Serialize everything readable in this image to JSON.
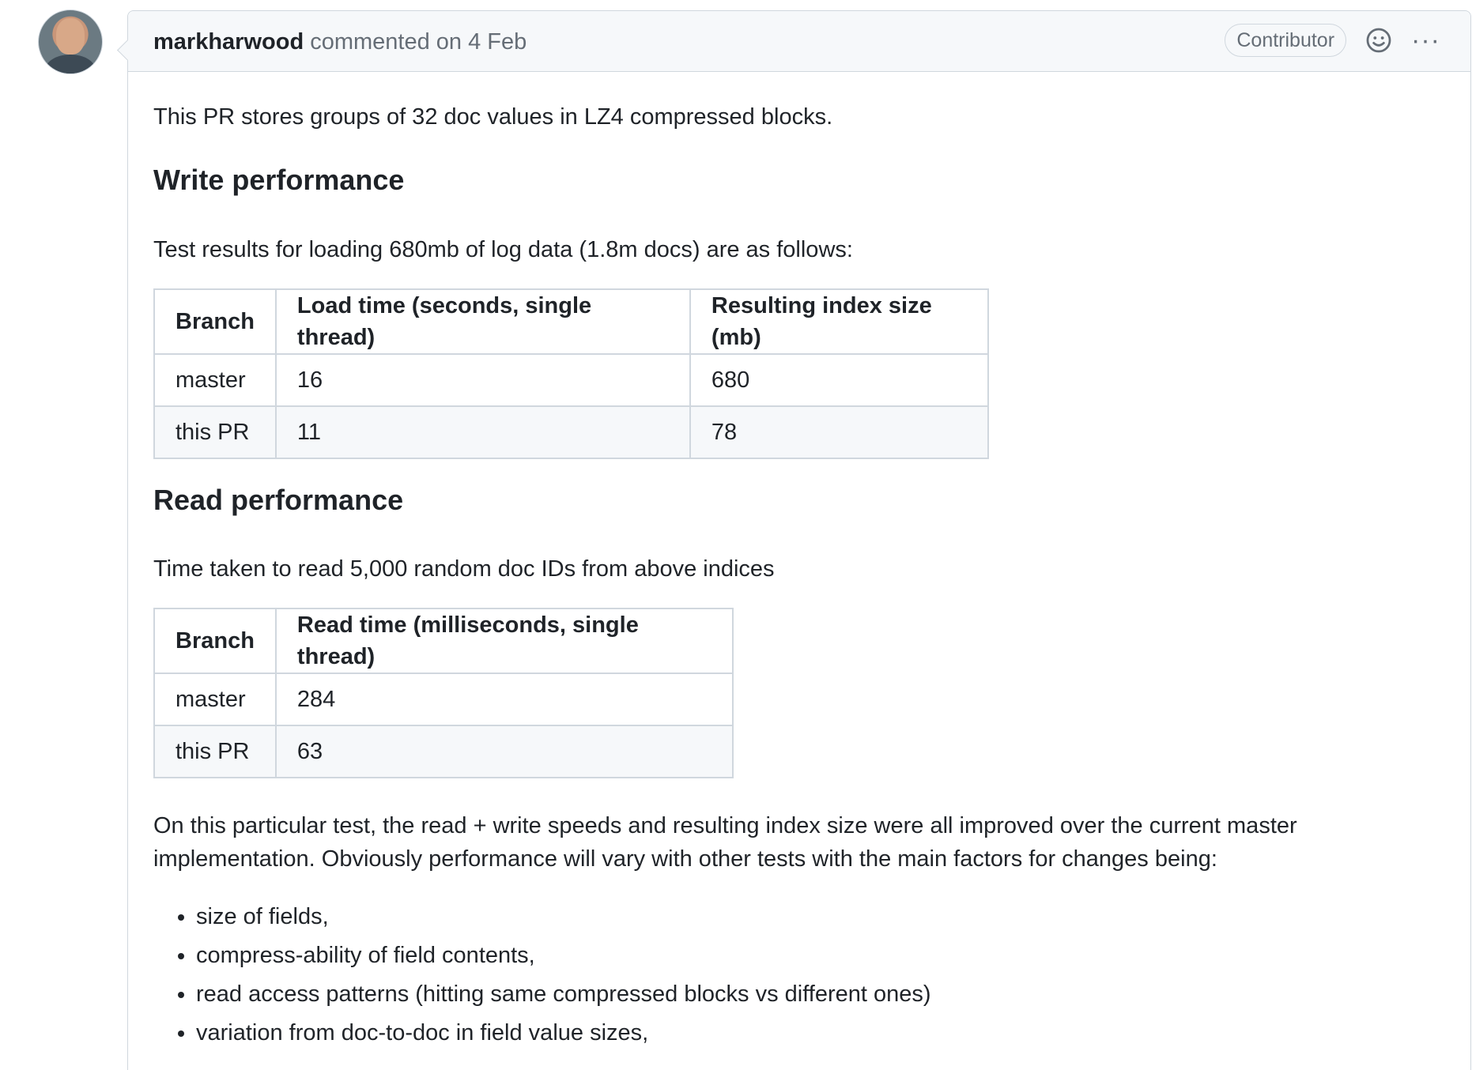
{
  "comment": {
    "author": "markharwood",
    "action": "commented on 4 Feb",
    "badge": "Contributor",
    "icons": {
      "reaction": "smiley-icon",
      "menu": "kebab-menu-icon"
    },
    "menu_glyph": "···"
  },
  "body": {
    "intro": "This PR stores groups of 32 doc values in LZ4 compressed blocks.",
    "write_heading": "Write performance",
    "write_desc": "Test results for loading 680mb of log data (1.8m docs) are as follows:",
    "write_table": {
      "headers": [
        "Branch",
        "Load time (seconds, single thread)",
        "Resulting index size (mb)"
      ],
      "rows": [
        [
          "master",
          "16",
          "680"
        ],
        [
          "this PR",
          "11",
          "78"
        ]
      ]
    },
    "read_heading": "Read performance",
    "read_desc": "Time taken to read 5,000 random doc IDs from above indices",
    "read_table": {
      "headers": [
        "Branch",
        "Read time (milliseconds, single thread)"
      ],
      "rows": [
        [
          "master",
          "284"
        ],
        [
          "this PR",
          "63"
        ]
      ]
    },
    "summary": "On this particular test, the read + write speeds and resulting index size were all improved over the current master implementation. Obviously performance will vary with other tests with the main factors for changes being:",
    "factors": [
      "size of fields,",
      "compress-ability of field contents,",
      "read access patterns (hitting same compressed blocks vs different ones)",
      "variation from doc-to-doc in field value sizes,"
    ]
  },
  "colors": {
    "border": "#d0d7de",
    "header_bg": "#f6f8fa",
    "muted_text": "#656d76",
    "text": "#1f2328"
  }
}
